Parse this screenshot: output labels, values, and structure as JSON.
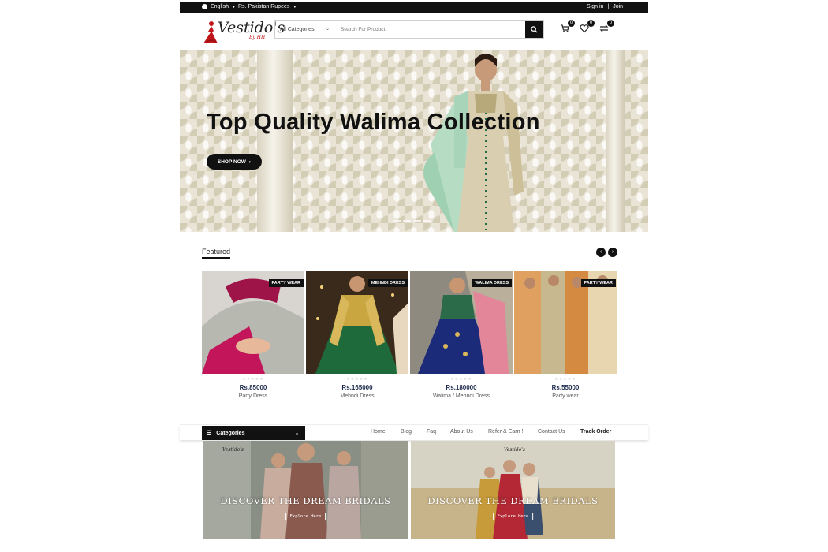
{
  "topbar": {
    "language": "English",
    "currency": "Rs. Pakistan Rupees",
    "sign_in": "Sign in",
    "separator": "|",
    "join": "Join"
  },
  "header": {
    "logo_text": "Vestido's",
    "logo_sub": "By HH",
    "category_select": "All Categories",
    "search_placeholder": "Search For Product",
    "cart_count": "0",
    "wishlist_count": "0",
    "compare_count": "0"
  },
  "hero": {
    "title": "Top Quality Walima Collection",
    "button": "SHOP NOW"
  },
  "featured": {
    "title": "Featured",
    "products": [
      {
        "tag": "PARTY WEAR",
        "price": "Rs.85000",
        "name": "Party Dress",
        "stars": "★★★★★"
      },
      {
        "tag": "MEHNDI DRESS",
        "price": "Rs.165000",
        "name": "Mehndi Dress",
        "stars": "★★★★★"
      },
      {
        "tag": "WALIMA DRESS",
        "price": "Rs.180000",
        "name": "Walima / Mehndi Dress",
        "stars": "★★★★★"
      },
      {
        "tag": "PARTY WEAR",
        "price": "Rs.55000",
        "name": "Party wear",
        "stars": "★★★★★"
      }
    ]
  },
  "nav": {
    "categories": "Categories",
    "menu": [
      "Home",
      "Blog",
      "Faq",
      "About Us",
      "Refer & Earn !",
      "Contact Us",
      "Track Order"
    ]
  },
  "banners": [
    {
      "logo": "Vestido's",
      "title": "DISCOVER THE DREAM BRIDALS",
      "button": "Explore Here"
    },
    {
      "logo": "Vestido's",
      "title": "DISCOVER THE DREAM BRIDALS",
      "button": "Explore Here"
    }
  ],
  "colors": {
    "primary": "#111111",
    "price": "#1d2b4d",
    "logo_red": "#c0151a"
  }
}
